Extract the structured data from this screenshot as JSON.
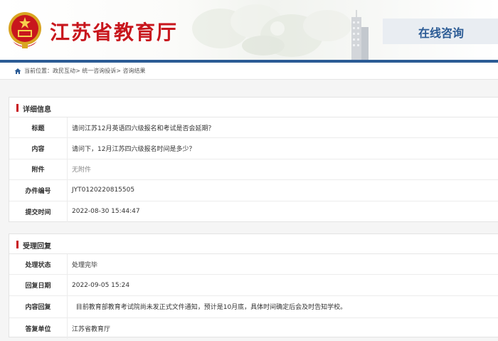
{
  "header": {
    "site_title": "江苏省教育厅",
    "online_tab": "在线咨询",
    "colors": {
      "primary": "#2b5b95",
      "accent": "#c8161d"
    }
  },
  "breadcrumb": {
    "icon": "home-icon",
    "text": "当前位置：政民互动> 统一咨询投诉> 咨询结果"
  },
  "details": {
    "section_title": "详细信息",
    "rows": [
      {
        "label": "标题",
        "value": "请问江苏12月英语四六级报名和考试是否会延期？"
      },
      {
        "label": "内容",
        "value": "请问下，12月江苏四六级报名时间是多少？"
      },
      {
        "label": "附件",
        "value": "无附件"
      },
      {
        "label": "办件编号",
        "value": "JYT0120220815505"
      },
      {
        "label": "提交时间",
        "value": "2022-08-30 15:44:47"
      }
    ]
  },
  "reply": {
    "section_title": "受理回复",
    "rows": [
      {
        "label": "处理状态",
        "value": "处理完毕"
      },
      {
        "label": "回复日期",
        "value": "2022-09-05 15:24"
      },
      {
        "label": "内容回复",
        "value": "  目前教育部教育考试院尚未发正式文件通知，预计是10月底，具体时间确定后会及时告知学校。"
      },
      {
        "label": "答复单位",
        "value": "江苏省教育厅"
      }
    ]
  }
}
